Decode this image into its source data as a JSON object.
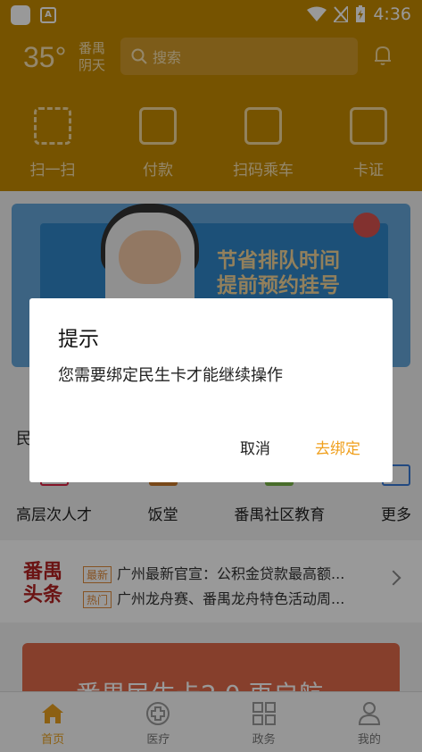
{
  "status_bar": {
    "time": "4:36",
    "notification_icon_label": "A"
  },
  "header": {
    "temperature": "35°",
    "location": "番禺",
    "weather": "阴天",
    "search_placeholder": "搜索"
  },
  "quick_actions": [
    {
      "label": "扫一扫",
      "icon": "scan-icon"
    },
    {
      "label": "付款",
      "icon": "barcode-icon"
    },
    {
      "label": "扫码乘车",
      "icon": "qrcode-icon"
    },
    {
      "label": "卡证",
      "icon": "wallet-icon"
    }
  ],
  "banner": {
    "line1": "节省排队时间",
    "line2": "提前预约挂号"
  },
  "section_label": "民",
  "services": [
    {
      "label": "高层次人才",
      "icon": "talent-icon"
    },
    {
      "label": "饭堂",
      "icon": "canteen-icon"
    },
    {
      "label": "番禺社区教育",
      "icon": "education-icon"
    },
    {
      "label": "更多",
      "icon": "grid-icon"
    }
  ],
  "news": {
    "logo_line1": "番禺",
    "logo_line2": "头条",
    "items": [
      {
        "tag": "最新",
        "text": "广州最新官宣：公积金贷款最高额..."
      },
      {
        "tag": "热门",
        "text": "广州龙舟赛、番禺龙舟特色活动周..."
      }
    ]
  },
  "promo": {
    "text": "番禺民生卡2.0 再启航"
  },
  "tabbar": [
    {
      "label": "首页",
      "icon": "home-icon",
      "active": true
    },
    {
      "label": "医疗",
      "icon": "medical-icon",
      "active": false
    },
    {
      "label": "政务",
      "icon": "government-icon",
      "active": false
    },
    {
      "label": "我的",
      "icon": "profile-icon",
      "active": false
    }
  ],
  "dialog": {
    "title": "提示",
    "message": "您需要绑定民生卡才能继续操作",
    "cancel_label": "取消",
    "confirm_label": "去绑定"
  },
  "colors": {
    "header_bg": "#c58a00",
    "accent": "#f0a01e",
    "overlay": "rgba(0,0,0,0.40)"
  }
}
